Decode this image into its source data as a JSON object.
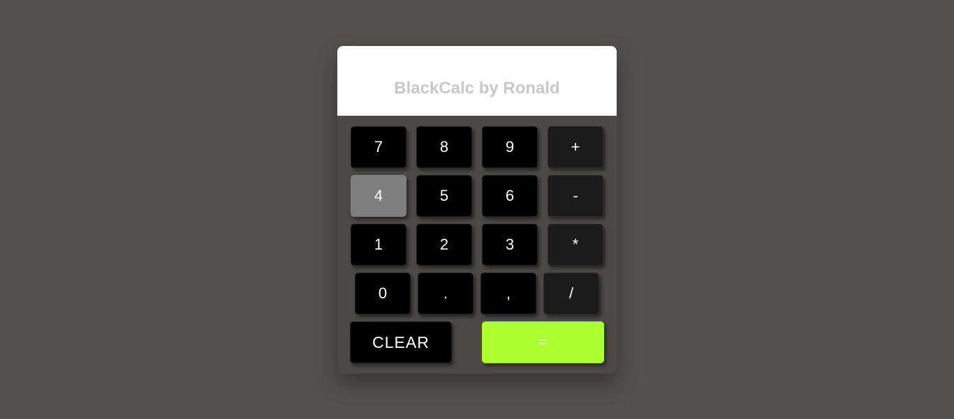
{
  "display": {
    "text": "BlackCalc by Ronald"
  },
  "keys": {
    "k7": "7",
    "k8": "8",
    "k9": "9",
    "plus": "+",
    "k4": "4",
    "k5": "5",
    "k6": "6",
    "minus": "-",
    "k1": "1",
    "k2": "2",
    "k3": "3",
    "times": "*",
    "k0": "0",
    "dot": ".",
    "comma": ",",
    "divide": "/",
    "clear": "CLEAR",
    "equals": "="
  },
  "colors": {
    "background": "#52514f",
    "display": "#ffffff",
    "key": "#000000",
    "operator_key": "#1b1b1b",
    "hovered_key": "#7f7f7f",
    "equals_key": "#adff2f"
  }
}
